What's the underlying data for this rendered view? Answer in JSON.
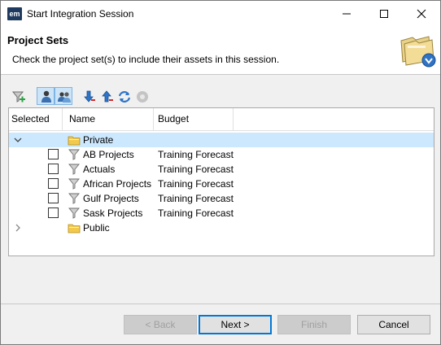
{
  "window": {
    "icon_text": "em",
    "title": "Start Integration Session"
  },
  "banner": {
    "title": "Project Sets",
    "description": "Check the project set(s) to include their assets in this session."
  },
  "toolbar": {
    "buttons": [
      {
        "icon": "filter-add-icon"
      },
      {
        "icon": "single-user-icon",
        "toggled": true
      },
      {
        "icon": "multi-user-icon",
        "toggled": true
      },
      {
        "icon": "move-down-icon"
      },
      {
        "icon": "move-up-icon"
      },
      {
        "icon": "refresh-icon"
      },
      {
        "icon": "disabled-gear-icon"
      }
    ]
  },
  "table": {
    "columns": [
      "Selected",
      "Name",
      "Budget"
    ],
    "groups": [
      {
        "name": "Private",
        "expanded": true,
        "items": [
          {
            "name": "AB Projects",
            "budget": "Training Forecast",
            "checked": false
          },
          {
            "name": "Actuals",
            "budget": "Training Forecast",
            "checked": false
          },
          {
            "name": "African Projects",
            "budget": "Training Forecast",
            "checked": false
          },
          {
            "name": "Gulf Projects",
            "budget": "Training Forecast",
            "checked": false
          },
          {
            "name": "Sask Projects",
            "budget": "Training Forecast",
            "checked": false
          }
        ]
      },
      {
        "name": "Public",
        "expanded": false,
        "items": []
      }
    ]
  },
  "buttons": {
    "back": "< Back",
    "next": "Next >",
    "finish": "Finish",
    "cancel": "Cancel"
  },
  "colors": {
    "selection": "#cce8ff",
    "accent": "#0078d7",
    "folder": "#f2c94c"
  }
}
